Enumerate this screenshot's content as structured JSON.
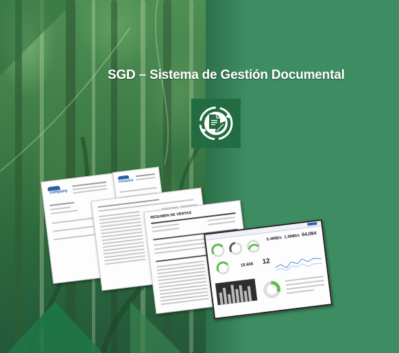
{
  "page": {
    "title": "SGD – Sistema de Gestión Documental"
  },
  "logo": {
    "icon": "document-leaf-cycle-icon"
  },
  "documents": {
    "invoice": {
      "brand": "company"
    },
    "receipt": {
      "brand": "company"
    },
    "sales_report": {
      "heading": "RESUMEN DE VENTAS"
    },
    "dashboard": {
      "kpi_1": "0.4MB/s",
      "kpi_2": "1.9MB/s",
      "kpi_3": "64,084",
      "kpi_4": "18.608",
      "kpi_5": "12"
    }
  },
  "colors": {
    "panel_green": "#3e8c61",
    "logo_green": "#236b40",
    "gauge_green": "#5bbf4a"
  }
}
